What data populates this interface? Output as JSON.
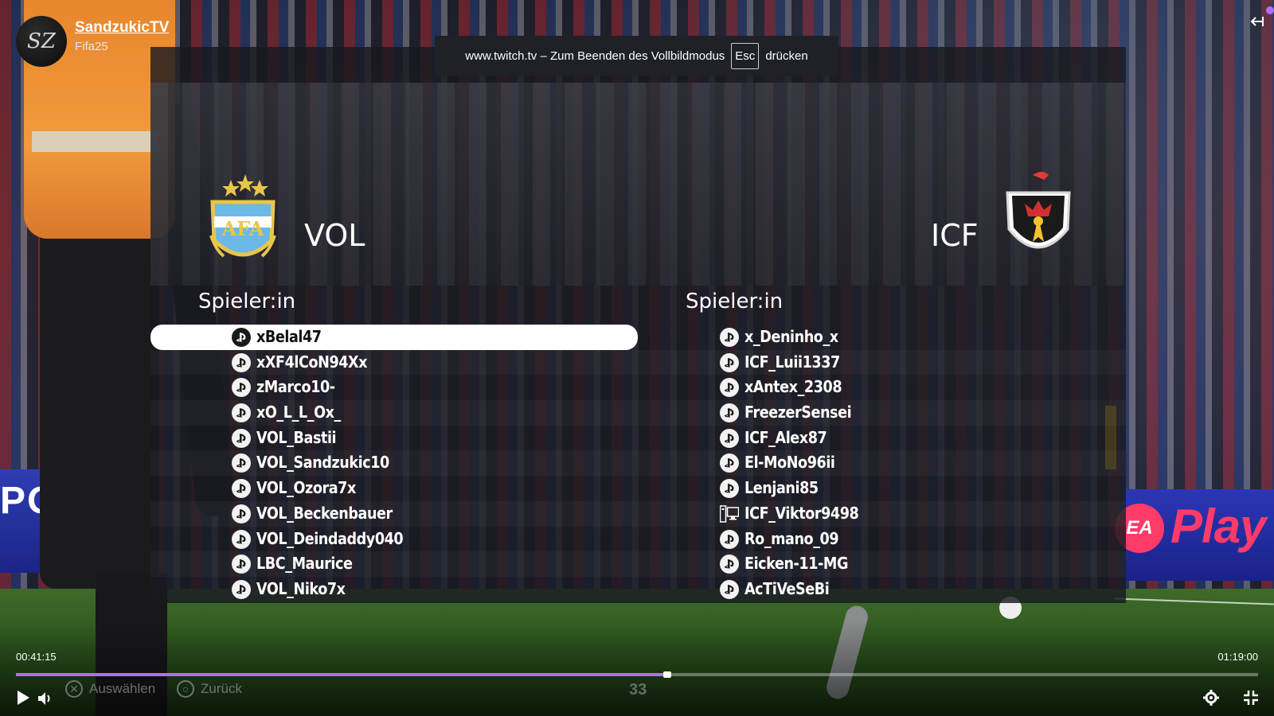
{
  "channel": {
    "avatar_initials": "SZ",
    "name": "SandzukicTV",
    "game": "Fifa25"
  },
  "fullscreen_notice": {
    "text_before": "www.twitch.tv – Zum Beenden des Vollbildmodus",
    "key": "Esc",
    "text_after": "drücken"
  },
  "match": {
    "home": {
      "short_name": "VOL",
      "crest": "argentina-afa-crest",
      "column_header": "Spieler:in",
      "players": [
        {
          "name": "xBelal47",
          "platform": "playstation",
          "selected": true
        },
        {
          "name": "xXF4lCoN94Xx",
          "platform": "playstation"
        },
        {
          "name": "zMarco10-",
          "platform": "playstation"
        },
        {
          "name": "xO_L_L_Ox_",
          "platform": "playstation"
        },
        {
          "name": "VOL_Bastii",
          "platform": "playstation"
        },
        {
          "name": "VOL_Sandzukic10",
          "platform": "playstation"
        },
        {
          "name": "VOL_Ozora7x",
          "platform": "playstation"
        },
        {
          "name": "VOL_Beckenbauer",
          "platform": "playstation"
        },
        {
          "name": "VOL_Deindaddy040",
          "platform": "playstation"
        },
        {
          "name": "LBC_Maurice",
          "platform": "playstation"
        },
        {
          "name": "VOL_Niko7x",
          "platform": "playstation"
        }
      ]
    },
    "away": {
      "short_name": "ICF",
      "crest": "icf-football-club-crest",
      "column_header": "Spieler:in",
      "players": [
        {
          "name": "x_Deninho_x",
          "platform": "playstation"
        },
        {
          "name": "ICF_Luii1337",
          "platform": "playstation"
        },
        {
          "name": "xAntex_2308",
          "platform": "playstation"
        },
        {
          "name": "FreezerSensei",
          "platform": "playstation"
        },
        {
          "name": "ICF_Alex87",
          "platform": "playstation"
        },
        {
          "name": "El-MoNo96ii",
          "platform": "playstation"
        },
        {
          "name": "Lenjani85",
          "platform": "playstation"
        },
        {
          "name": "ICF_Viktor9498",
          "platform": "pc"
        },
        {
          "name": "Ro_mano_09",
          "platform": "playstation"
        },
        {
          "name": "Eicken-11-MG",
          "platform": "playstation"
        },
        {
          "name": "AcTiVeSeBi",
          "platform": "playstation"
        }
      ]
    }
  },
  "game_hints": {
    "select_label": "Auswählen",
    "back_label": "Zurück",
    "clock": "33"
  },
  "player": {
    "time_current": "00:41:15",
    "time_total": "01:19:00",
    "progress_fraction": 0.5222,
    "accent_color": "#a970ff"
  },
  "background": {
    "banner_left_text": "POR",
    "ea_logo_text": "EA",
    "play_text": "Play"
  }
}
